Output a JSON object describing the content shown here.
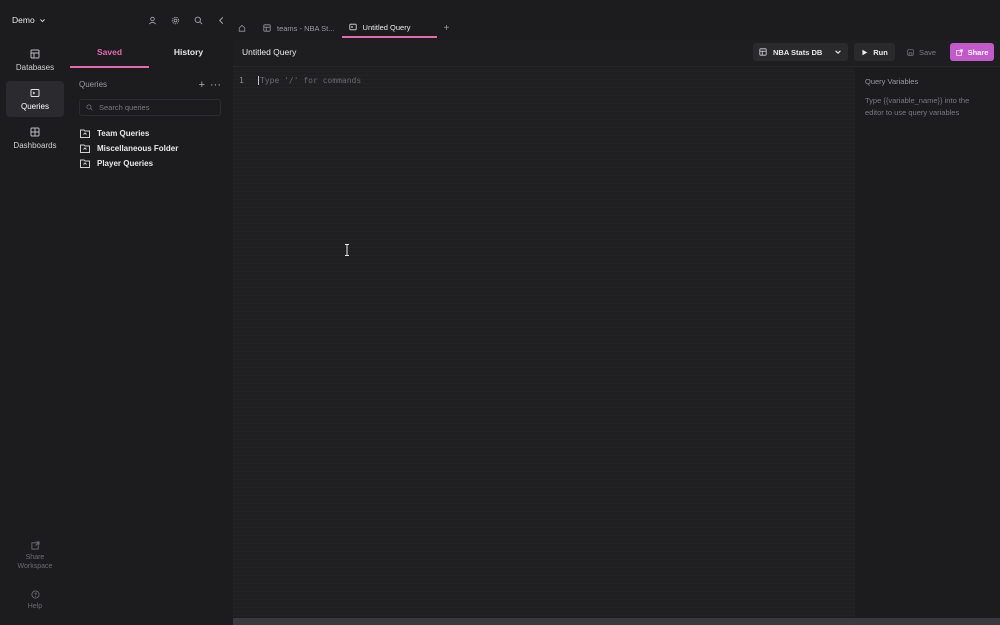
{
  "workspace": {
    "name": "Demo"
  },
  "rail": {
    "items": [
      {
        "label": "Databases",
        "icon": "database-icon"
      },
      {
        "label": "Queries",
        "icon": "queries-icon",
        "active": true
      },
      {
        "label": "Dashboards",
        "icon": "dashboard-icon"
      }
    ],
    "share_workspace": "Share\nWorkspace",
    "help": "Help"
  },
  "panel": {
    "tabs": [
      {
        "label": "Saved",
        "active": true
      },
      {
        "label": "History"
      }
    ],
    "queries_label": "Queries",
    "add_label": "+",
    "more_label": "···",
    "search_placeholder": "Search queries",
    "folders": [
      "Team Queries",
      "Miscellaneous Folder",
      "Player Queries"
    ]
  },
  "editor_tabs": [
    {
      "label": "teams - NBA St...",
      "icon": "table-icon"
    },
    {
      "label": "Untitled Query",
      "icon": "query-icon",
      "active": true
    }
  ],
  "new_tab_label": "+",
  "toolbar": {
    "title": "Untitled Query",
    "database": "NBA Stats DB",
    "run": "Run",
    "save": "Save",
    "share": "Share"
  },
  "editor": {
    "line_number": "1",
    "placeholder": "Type '/' for commands"
  },
  "variables": {
    "title": "Query Variables",
    "help": "Type {{variable_name}} into the editor to use query variables"
  },
  "colors": {
    "accent": "#e26cae",
    "share_button": "#c25ac9"
  }
}
